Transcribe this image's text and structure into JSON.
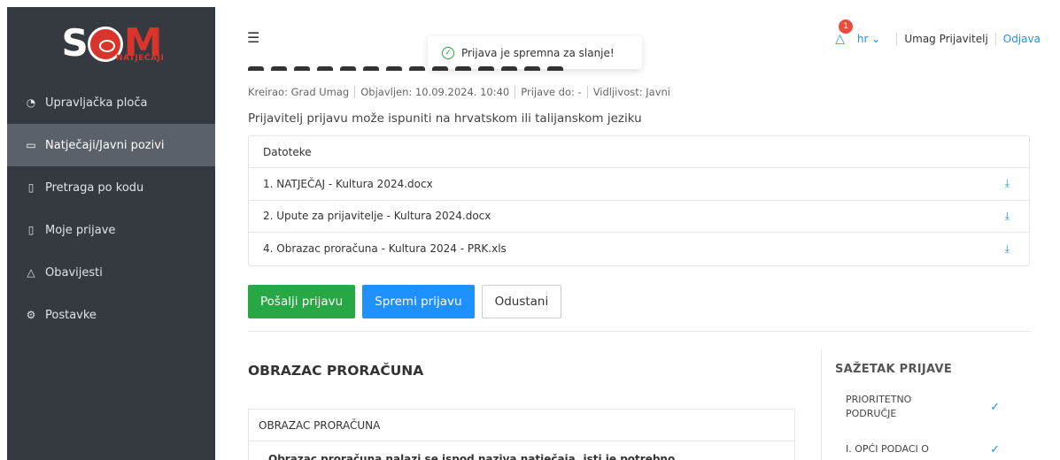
{
  "brand": {
    "logo_text_main": "SOM",
    "logo_sub": "NATJEČAJI"
  },
  "sidebar": {
    "items": [
      {
        "icon": "dashboard-icon",
        "glyph": "◔",
        "label": "Upravljačka ploča"
      },
      {
        "icon": "folder-icon",
        "glyph": "🗁",
        "label": "Natječaji/Javni pozivi"
      },
      {
        "icon": "file-search-icon",
        "glyph": "🗋",
        "label": "Pretraga po kodu"
      },
      {
        "icon": "document-icon",
        "glyph": "🗎",
        "label": "Moje prijave"
      },
      {
        "icon": "bell-icon",
        "glyph": "🔔",
        "label": "Obavijesti"
      },
      {
        "icon": "gear-icon",
        "glyph": "⚙",
        "label": "Postavke"
      }
    ],
    "active_index": 1
  },
  "topbar": {
    "toast": "Prijava je spremna za slanje!",
    "notifications_count": "1",
    "lang": "hr",
    "user": "Umag Prijavitelj",
    "logout": "Odjava"
  },
  "meta": {
    "created_by": "Kreirao: Grad Umag",
    "published": "Objavljen: 10.09.2024. 10:40",
    "deadline": "Prijave do: -",
    "visibility": "Vidljivost: Javni"
  },
  "lead": "Prijavitelj prijavu može ispuniti na hrvatskom ili talijanskom jeziku",
  "files": {
    "header": "Datoteke",
    "items": [
      "1. NATJEČAJ - Kultura 2024.docx",
      "2. Upute za prijavitelje - Kultura 2024.docx",
      "4. Obrazac proračuna - Kultura 2024 - PRK.xls"
    ]
  },
  "actions": {
    "send": "Pošalji prijavu",
    "save": "Spremi prijavu",
    "cancel": "Odustani"
  },
  "form": {
    "section_title": "OBRAZAC PRORAČUNA",
    "box_header": "OBRAZAC PRORAČUNA",
    "box_text": "Obrazac proračuna nalazi se ispod naziva natječaja, isti je potrebno"
  },
  "summary": {
    "title": "SAŽETAK PRIJAVE",
    "items": [
      {
        "label": "PRIORITETNO PODRUČJE",
        "done": true
      },
      {
        "label": "I. OPĆI PODACI O",
        "done": true
      }
    ]
  },
  "colors": {
    "accent": "#1e90ff",
    "success": "#28a745",
    "sidebar": "#343a40",
    "brand_red": "#d9342b"
  }
}
